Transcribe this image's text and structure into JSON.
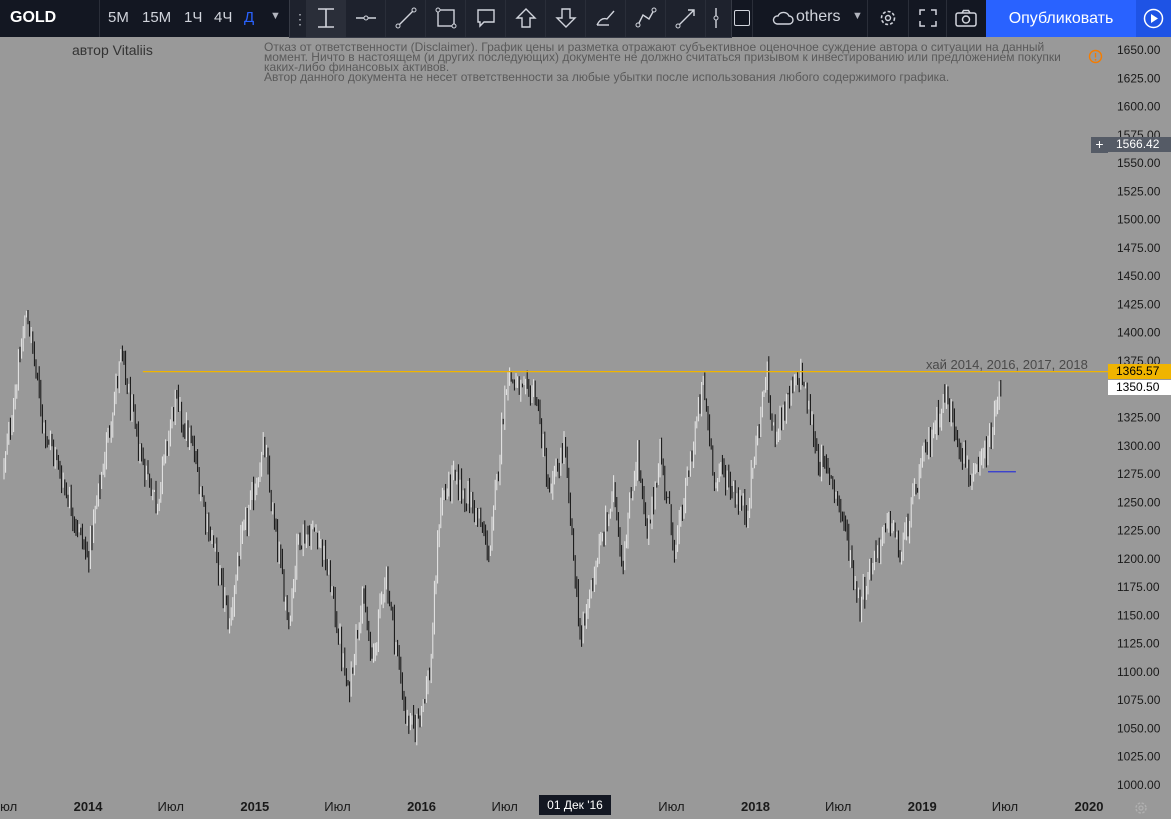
{
  "toolbar": {
    "symbol": "GOLD",
    "intervals": [
      "5М",
      "15М",
      "1Ч",
      "4Ч",
      "Д"
    ],
    "active_interval": "Д",
    "others_label": "others",
    "publish_label": "Опубликовать"
  },
  "author": "автор Vitaliis",
  "disclaimer": [
    "Отказ от ответственности (Disclaimer). График цены и разметка отражают субъективное оценочное суждение автора о ситуации на данный",
    "момент. Ничто в настоящем (и других последующих) документе не должно считаться призывом к инвестированию или предложением покупки",
    "каких-либо финансовых активов.",
    "Автор данного документа не несет ответственности за любые убытки после использования любого содержимого графика."
  ],
  "annotation": "хай 2014, 2016, 2017, 2018",
  "crosshair": {
    "price": "1566.42",
    "date": "01 Дек '16"
  },
  "colors": {
    "accent": "#2962ff",
    "level_line": "#f0b400",
    "support_line": "#2f37d4",
    "background": "#999999",
    "candles": "#111111"
  },
  "chart_data": {
    "type": "line",
    "style": "ohlc bars",
    "ylim": [
      993,
      1663
    ],
    "y_ticks": [
      1000,
      1025,
      1050,
      1075,
      1100,
      1125,
      1150,
      1175,
      1200,
      1225,
      1250,
      1275,
      1300,
      1325,
      1350,
      1375,
      1400,
      1425,
      1450,
      1475,
      1500,
      1525,
      1550,
      1575,
      1600,
      1625,
      1650
    ],
    "y_tick_labels": [
      "1000.00",
      "1025.00",
      "1050.00",
      "1075.00",
      "1100.00",
      "1125.00",
      "1150.00",
      "1175.00",
      "1200.00",
      "1225.00",
      "1250.00",
      "1275.00",
      "1300.00",
      "1325.00",
      "1350.00",
      "1375.00",
      "1400.00",
      "1425.00",
      "1450.00",
      "1475.00",
      "1500.00",
      "1525.00",
      "1550.00",
      "1575.00",
      "1600.00",
      "1625.00",
      "1650.00"
    ],
    "x_ticks": [
      "2013-07-01",
      "2014-01-01",
      "2014-07-01",
      "2015-01-01",
      "2015-07-01",
      "2016-01-01",
      "2016-07-01",
      "2017-07-01",
      "2018-01-01",
      "2018-07-01",
      "2019-01-01",
      "2019-07-01",
      "2020-01-01"
    ],
    "x_tick_labels": [
      "Июл",
      "2014",
      "Июл",
      "2015",
      "Июл",
      "2016",
      "Июл",
      "Июл",
      "2018",
      "Июл",
      "2019",
      "Июл",
      "2020"
    ],
    "price_path": [
      [
        "2013-07-01",
        1280
      ],
      [
        "2013-08-20",
        1420
      ],
      [
        "2013-09-25",
        1320
      ],
      [
        "2013-11-15",
        1260
      ],
      [
        "2013-12-31",
        1200
      ],
      [
        "2014-03-15",
        1380
      ],
      [
        "2014-04-20",
        1300
      ],
      [
        "2014-06-01",
        1250
      ],
      [
        "2014-07-10",
        1340
      ],
      [
        "2014-08-20",
        1295
      ],
      [
        "2014-09-15",
        1240
      ],
      [
        "2014-10-01",
        1215
      ],
      [
        "2014-11-07",
        1140
      ],
      [
        "2014-11-25",
        1200
      ],
      [
        "2015-01-22",
        1300
      ],
      [
        "2015-02-10",
        1235
      ],
      [
        "2015-03-17",
        1145
      ],
      [
        "2015-04-06",
        1220
      ],
      [
        "2015-05-18",
        1225
      ],
      [
        "2015-06-15",
        1180
      ],
      [
        "2015-07-24",
        1080
      ],
      [
        "2015-08-24",
        1170
      ],
      [
        "2015-09-15",
        1105
      ],
      [
        "2015-10-14",
        1190
      ],
      [
        "2015-11-30",
        1055
      ],
      [
        "2015-12-17",
        1050
      ],
      [
        "2016-01-20",
        1100
      ],
      [
        "2016-02-11",
        1250
      ],
      [
        "2016-03-10",
        1270
      ],
      [
        "2016-04-20",
        1250
      ],
      [
        "2016-05-30",
        1205
      ],
      [
        "2016-07-06",
        1365
      ],
      [
        "2016-08-10",
        1345
      ],
      [
        "2016-09-06",
        1350
      ],
      [
        "2016-10-07",
        1255
      ],
      [
        "2016-11-08",
        1300
      ],
      [
        "2016-12-15",
        1125
      ],
      [
        "2017-01-10",
        1185
      ],
      [
        "2017-02-27",
        1260
      ],
      [
        "2017-03-15",
        1195
      ],
      [
        "2017-04-17",
        1295
      ],
      [
        "2017-05-09",
        1215
      ],
      [
        "2017-06-06",
        1295
      ],
      [
        "2017-07-10",
        1205
      ],
      [
        "2017-09-08",
        1355
      ],
      [
        "2017-10-06",
        1265
      ],
      [
        "2017-10-20",
        1280
      ],
      [
        "2017-12-12",
        1240
      ],
      [
        "2018-01-25",
        1365
      ],
      [
        "2018-02-08",
        1310
      ],
      [
        "2018-04-11",
        1365
      ],
      [
        "2018-05-21",
        1285
      ],
      [
        "2018-06-15",
        1275
      ],
      [
        "2018-07-15",
        1230
      ],
      [
        "2018-08-16",
        1160
      ],
      [
        "2018-09-20",
        1205
      ],
      [
        "2018-10-26",
        1235
      ],
      [
        "2018-11-13",
        1200
      ],
      [
        "2019-01-01",
        1285
      ],
      [
        "2019-02-20",
        1345
      ],
      [
        "2019-04-23",
        1265
      ],
      [
        "2019-05-31",
        1305
      ],
      [
        "2019-06-20",
        1350
      ],
      [
        "2019-06-25",
        1360
      ]
    ],
    "horizontal_levels": [
      {
        "price": 1365.57,
        "label": "1365.57",
        "from": "2014-05-01",
        "color": "#f0b400"
      },
      {
        "price": 1277,
        "from": "2019-05-25",
        "to": "2019-07-25",
        "color": "#2f37d4"
      }
    ],
    "last_price": "1350.50"
  }
}
